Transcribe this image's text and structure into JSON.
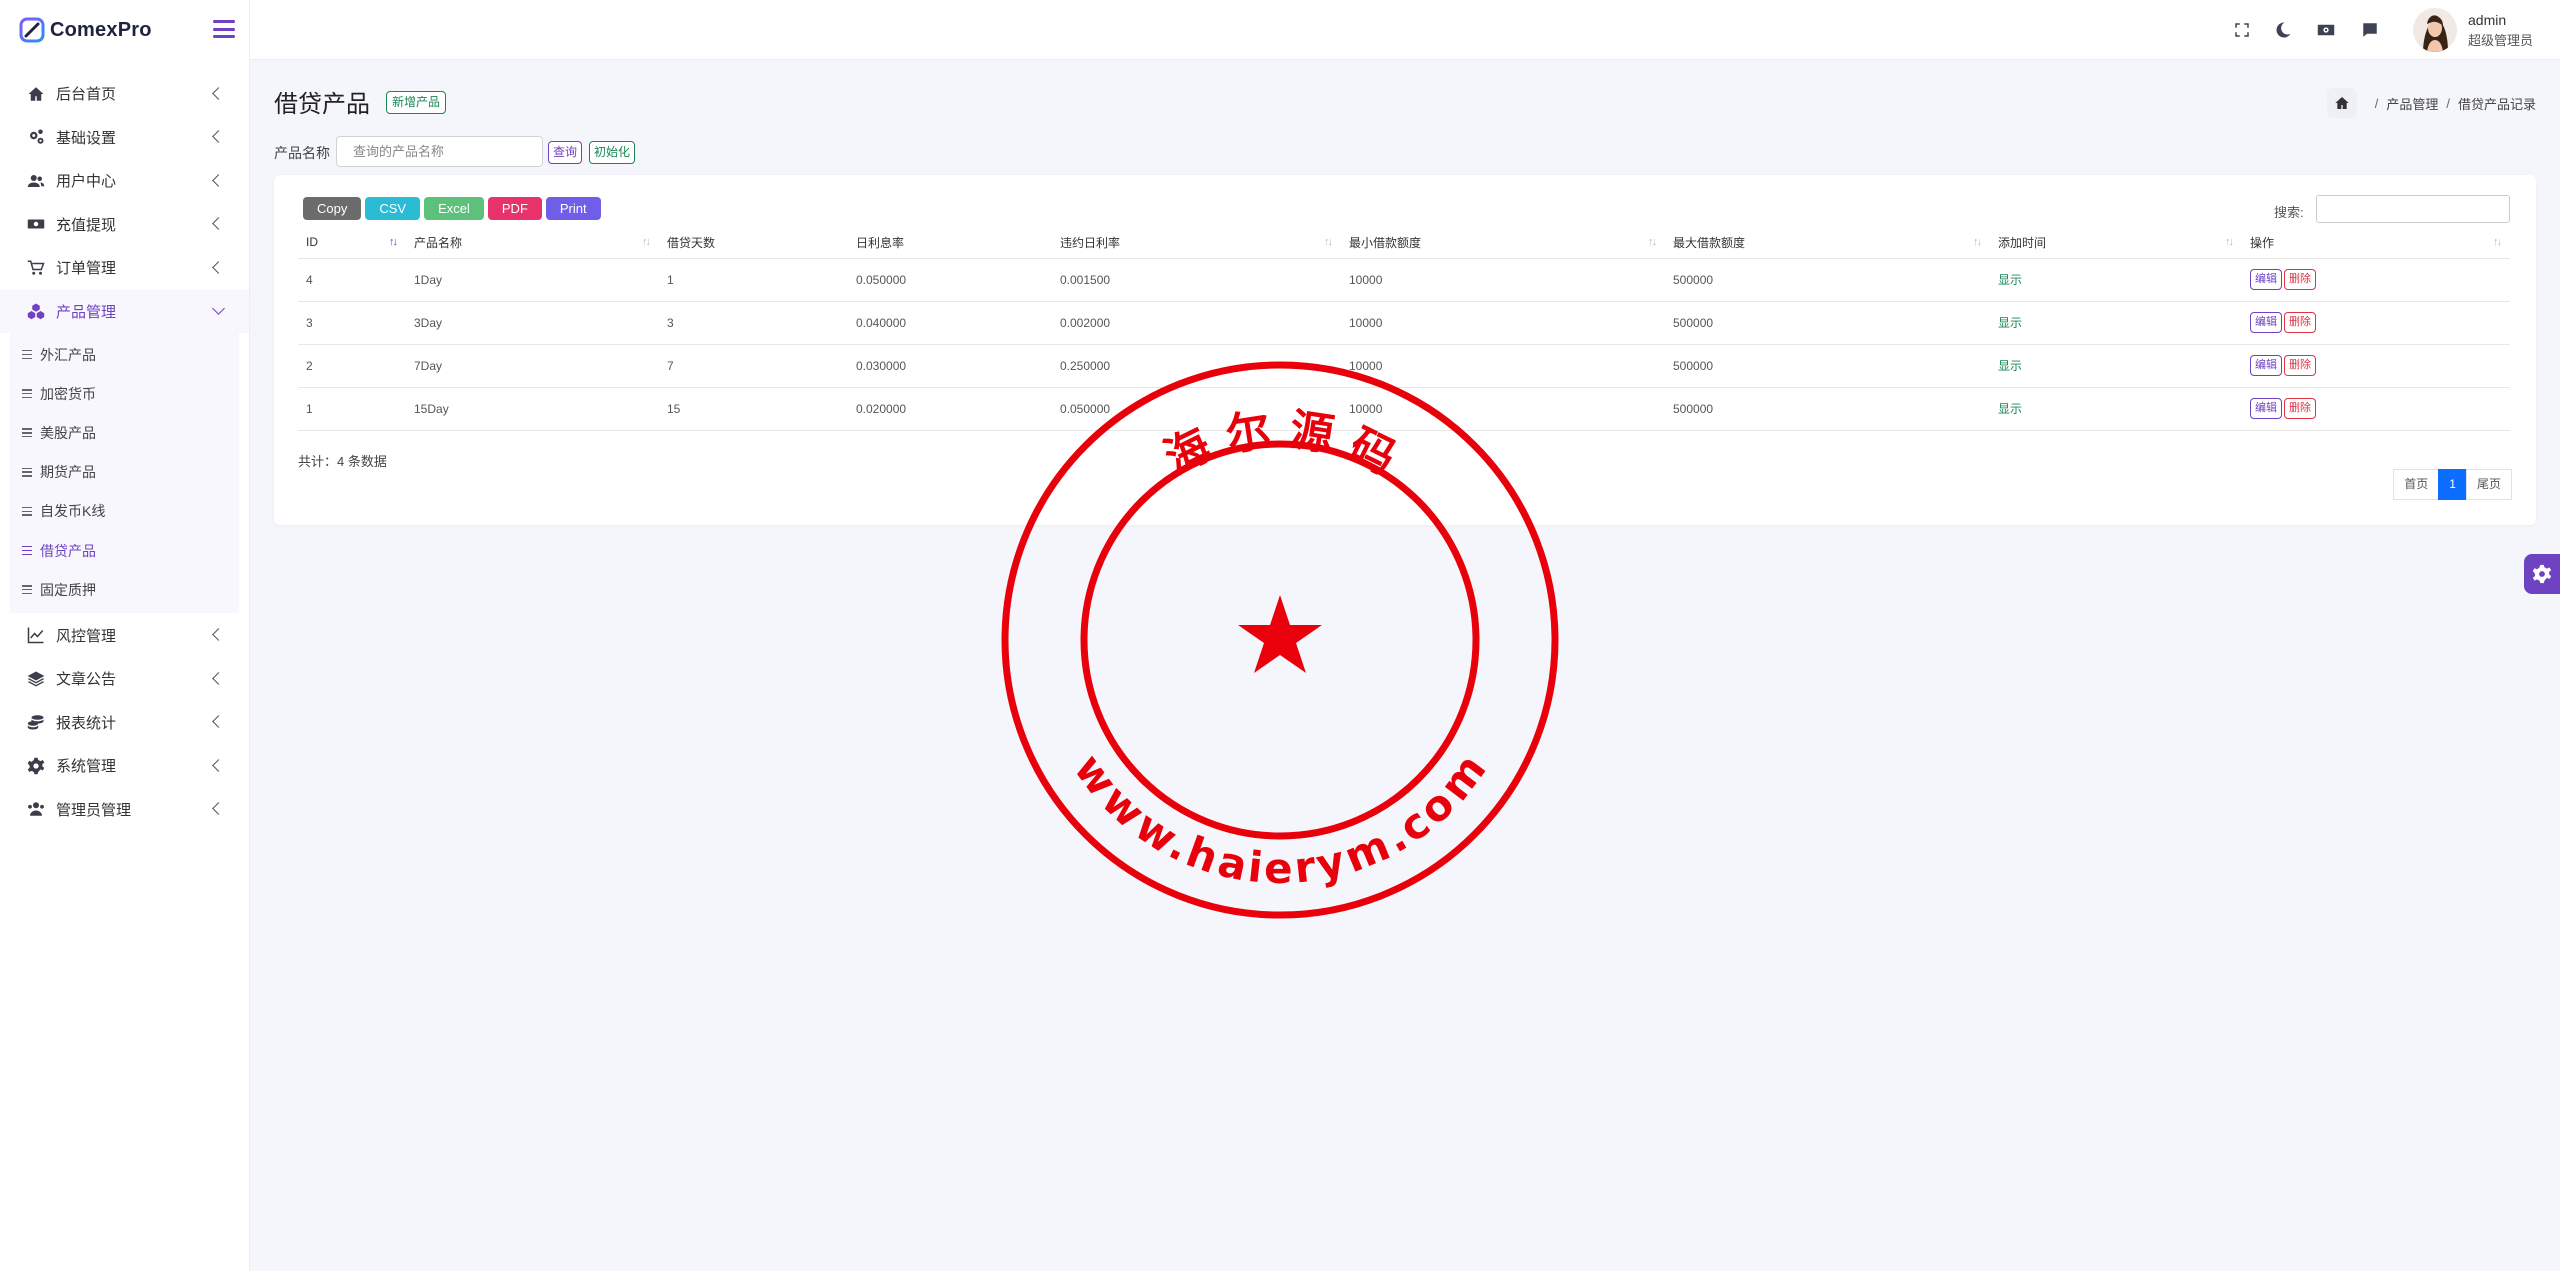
{
  "brand": {
    "name": "ComexPro"
  },
  "sidebar": {
    "items": [
      {
        "label": "后台首页",
        "icon": "home-icon"
      },
      {
        "label": "基础设置",
        "icon": "cogs-icon"
      },
      {
        "label": "用户中心",
        "icon": "users-icon"
      },
      {
        "label": "充值提现",
        "icon": "money-icon"
      },
      {
        "label": "订单管理",
        "icon": "cart-icon"
      },
      {
        "label": "产品管理",
        "icon": "cubes-icon"
      },
      {
        "label": "风控管理",
        "icon": "chart-line-icon"
      },
      {
        "label": "文章公告",
        "icon": "layers-icon"
      },
      {
        "label": "报表统计",
        "icon": "coins-icon"
      },
      {
        "label": "系统管理",
        "icon": "gear-icon"
      },
      {
        "label": "管理员管理",
        "icon": "user-group-icon"
      }
    ],
    "submenu": [
      {
        "label": "外汇产品"
      },
      {
        "label": "加密货币"
      },
      {
        "label": "美股产品"
      },
      {
        "label": "期货产品"
      },
      {
        "label": "自发币K线"
      },
      {
        "label": "借贷产品"
      },
      {
        "label": "固定质押"
      }
    ]
  },
  "topbar": {
    "user_name": "admin",
    "user_role": "超级管理员"
  },
  "page": {
    "title": "借贷产品",
    "new_button": "新增产品",
    "breadcrumb": [
      "产品管理",
      "借贷产品记录"
    ]
  },
  "filter": {
    "label": "产品名称",
    "placeholder": "查询的产品名称",
    "query_button": "查询",
    "reset_button": "初始化"
  },
  "toolbar": {
    "buttons": [
      {
        "label": "Copy",
        "color": "#6c6c6c"
      },
      {
        "label": "CSV",
        "color": "#2bbbd4"
      },
      {
        "label": "Excel",
        "color": "#5cc27b"
      },
      {
        "label": "PDF",
        "color": "#e8336a"
      },
      {
        "label": "Print",
        "color": "#6f5fe8"
      }
    ],
    "search_label": "搜索:"
  },
  "table": {
    "headers": [
      "ID",
      "产品名称",
      "借贷天数",
      "日利息率",
      "违约日利率",
      "最小借款额度",
      "最大借款额度",
      "添加时间",
      "操作"
    ],
    "rows": [
      {
        "id": "4",
        "name": "1Day",
        "days": "1",
        "rate": "0.050000",
        "penalty": "0.001500",
        "min": "10000",
        "max": "500000",
        "status": "显示"
      },
      {
        "id": "3",
        "name": "3Day",
        "days": "3",
        "rate": "0.040000",
        "penalty": "0.002000",
        "min": "10000",
        "max": "500000",
        "status": "显示"
      },
      {
        "id": "2",
        "name": "7Day",
        "days": "7",
        "rate": "0.030000",
        "penalty": "0.250000",
        "min": "10000",
        "max": "500000",
        "status": "显示"
      },
      {
        "id": "1",
        "name": "15Day",
        "days": "15",
        "rate": "0.020000",
        "penalty": "0.050000",
        "min": "10000",
        "max": "500000",
        "status": "显示"
      }
    ],
    "edit_label": "编辑",
    "delete_label": "删除",
    "total": "共计：4 条数据"
  },
  "pager": {
    "first": "首页",
    "current": "1",
    "last": "尾页"
  },
  "watermark": {
    "text_top": "海 尔 源 码",
    "text_bottom": "www.haierym.com"
  },
  "colors": {
    "accent": "#6f42c1",
    "success": "#198754",
    "danger": "#dc3545",
    "primary": "#0d6efd",
    "seal": "#e8000b"
  }
}
